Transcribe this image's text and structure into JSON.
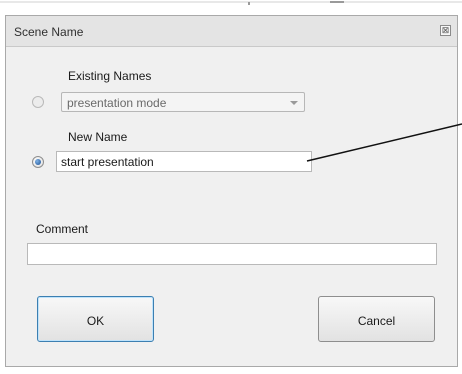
{
  "dialog": {
    "title": "Scene Name",
    "close_glyph": "⊠"
  },
  "existing": {
    "label": "Existing Names",
    "selected_value": "presentation mode",
    "enabled": false
  },
  "new_name": {
    "label": "New Name",
    "value": "start presentation",
    "selected": true
  },
  "comment": {
    "label": "Comment",
    "value": ""
  },
  "buttons": {
    "ok_label": "OK",
    "cancel_label": "Cancel"
  },
  "colors": {
    "accent_border": "#3c7fb1",
    "dialog_bg": "#f0f0f0"
  }
}
